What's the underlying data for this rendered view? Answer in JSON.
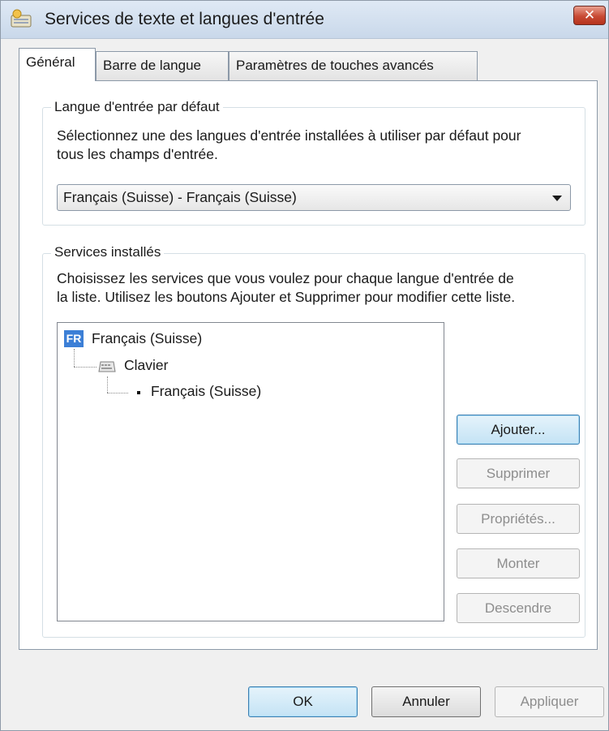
{
  "window": {
    "title": "Services de texte et langues d'entrée",
    "close_label": "✕"
  },
  "tabs": [
    {
      "label": "Général",
      "active": true
    },
    {
      "label": "Barre de langue",
      "active": false
    },
    {
      "label": "Paramètres de touches avancés",
      "active": false
    }
  ],
  "default_language": {
    "group_title": "Langue d'entrée par défaut",
    "description_line1": "Sélectionnez une des langues d'entrée installées à utiliser par défaut pour",
    "description_line2": "tous les champs d'entrée.",
    "selected": "Français (Suisse) - Français (Suisse)"
  },
  "installed_services": {
    "group_title": "Services installés",
    "description_line1": "Choisissez les services que vous voulez pour chaque langue d'entrée de",
    "description_line2": "la liste. Utilisez les boutons Ajouter et Supprimer pour modifier cette liste.",
    "tree": {
      "language_badge": "FR",
      "language": "Français (Suisse)",
      "category": "Clavier",
      "keyboard": "Français (Suisse)"
    },
    "buttons": {
      "add": "Ajouter...",
      "remove": "Supprimer",
      "properties": "Propriétés...",
      "move_up": "Monter",
      "move_down": "Descendre"
    }
  },
  "footer": {
    "ok": "OK",
    "cancel": "Annuler",
    "apply": "Appliquer"
  }
}
